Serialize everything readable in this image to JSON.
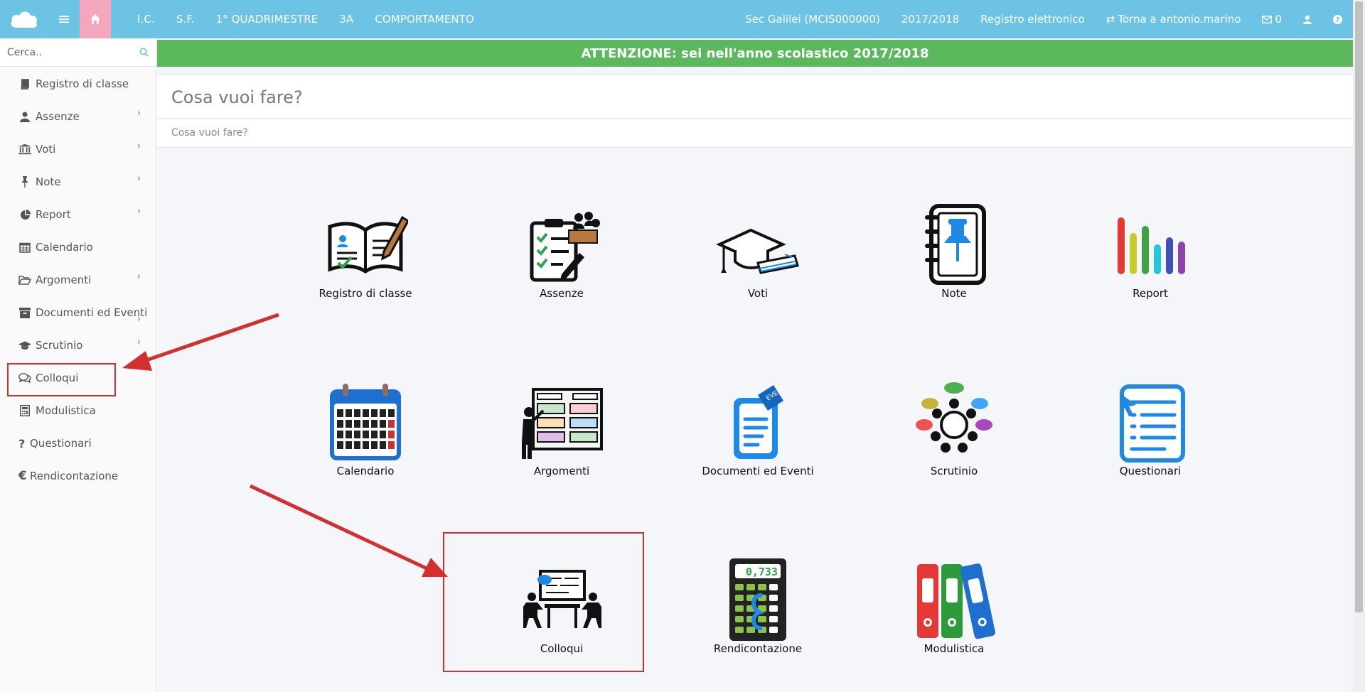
{
  "topbar": {
    "icons": {
      "logo": "cloud-logo",
      "menu": "hamburger-icon",
      "home": "home-icon"
    },
    "crumbs": [
      "I.C.",
      "S.F.",
      "1° QUADRIMESTRE",
      "3A",
      "COMPORTAMENTO"
    ],
    "school": "Sec Galilei (MCIS000000)",
    "year": "2017/2018",
    "app": "Registro elettronico",
    "back_link": "Torna a antonio.marino",
    "messages_count": "0"
  },
  "sidebar": {
    "search_placeholder": "Cerca..",
    "items": [
      {
        "label": "Registro di classe",
        "icon": "book-icon"
      },
      {
        "label": "Assenze",
        "icon": "user-icon"
      },
      {
        "label": "Voti",
        "icon": "bank-icon"
      },
      {
        "label": "Note",
        "icon": "pin-icon"
      },
      {
        "label": "Report",
        "icon": "pie-chart-icon"
      },
      {
        "label": "Calendario",
        "icon": "calendar-icon"
      },
      {
        "label": "Argomenti",
        "icon": "folder-open-icon"
      },
      {
        "label": "Documenti ed Eventi",
        "icon": "archive-icon"
      },
      {
        "label": "Scrutinio",
        "icon": "graduation-cap-icon"
      },
      {
        "label": "Colloqui",
        "icon": "comments-icon"
      },
      {
        "label": "Modulistica",
        "icon": "calculator-icon"
      },
      {
        "label": "Questionari",
        "icon": "question-icon"
      },
      {
        "label": "Rendicontazione",
        "icon": "euro-icon"
      }
    ]
  },
  "banner": "ATTENZIONE: sei nell'anno scolastico 2017/2018",
  "panel": {
    "title": "Cosa vuoi fare?",
    "breadcrumb": "Cosa vuoi fare?"
  },
  "tiles": [
    {
      "label": "Registro di classe",
      "icon": "open-book-icon"
    },
    {
      "label": "Assenze",
      "icon": "clipboard-checklist-icon"
    },
    {
      "label": "Voti",
      "icon": "graduation-cap-papers-icon"
    },
    {
      "label": "Note",
      "icon": "notebook-pin-icon"
    },
    {
      "label": "Report",
      "icon": "bar-chart-icon"
    },
    {
      "label": "Calendario",
      "icon": "calendar-icon"
    },
    {
      "label": "Argomenti",
      "icon": "teacher-board-icon"
    },
    {
      "label": "Documenti ed Eventi",
      "icon": "document-ticket-icon"
    },
    {
      "label": "Scrutinio",
      "icon": "meeting-round-table-icon"
    },
    {
      "label": "Questionari",
      "icon": "questionnaire-icon"
    },
    {
      "label": "Colloqui",
      "icon": "conversation-table-icon"
    },
    {
      "label": "Rendicontazione",
      "icon": "calculator-display-icon",
      "display": "0,733"
    },
    {
      "label": "Modulistica",
      "icon": "binders-icon"
    }
  ],
  "colors": {
    "topbar": "#6cc3e3",
    "home_button": "#f4a6bd",
    "banner": "#5cb85c",
    "annotation": "#d32f2f",
    "accent_blue": "#1e88e5"
  }
}
